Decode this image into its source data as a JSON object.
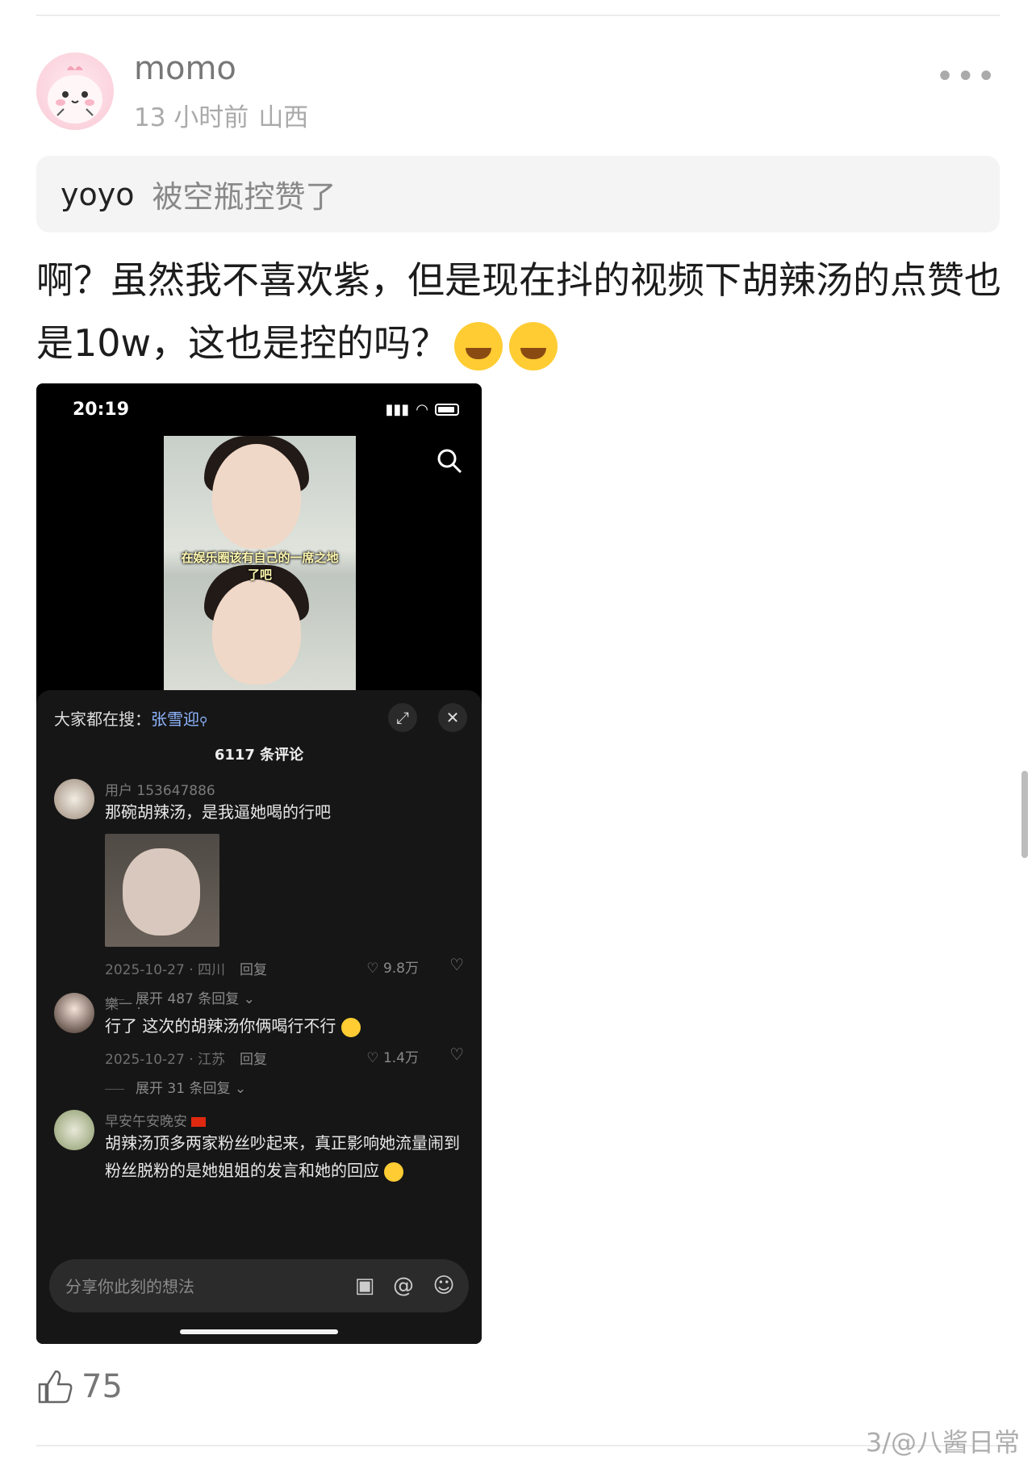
{
  "post": {
    "username": "momo",
    "time": "13 小时前",
    "location": "山西",
    "more_label": "•••",
    "quote": {
      "user": "yoyo",
      "text": "被空瓶控赞了"
    },
    "text": "啊？虽然我不喜欢紫，但是现在抖的视频下胡辣汤的点赞也是10w，这也是控的吗？",
    "likes": "75"
  },
  "screenshot": {
    "status_time": "20:19",
    "video_caption_1": "在娱乐圈该有自己的一席之地",
    "video_caption_2": "了吧",
    "trending_label": "大家都在搜：",
    "trending_keyword": "张雪迎",
    "comment_count": "6117 条评论",
    "comments": [
      {
        "name": "用户 153647886",
        "text": "那碗胡辣汤，是我逼她喝的行吧",
        "date": "2025-10-27 · 四川",
        "reply": "回复",
        "likes": "9.8万",
        "expand": "展开 487 条回复"
      },
      {
        "name": "樂一 .",
        "text": "行了 这次的胡辣汤你俩喝行不行",
        "date": "2025-10-27 · 江苏",
        "reply": "回复",
        "likes": "1.4万",
        "expand": "展开 31 条回复"
      },
      {
        "name": "早安午安晚安",
        "text": "胡辣汤顶多两家粉丝吵起来，真正影响她流量闹到粉丝脱粉的是她姐姐的发言和她的回应"
      }
    ],
    "input_placeholder": "分享你此刻的想法"
  },
  "watermark": "3/@八酱日常",
  "colors": {
    "accent_link": "#8fb6ff",
    "dark_panel": "#161616"
  }
}
